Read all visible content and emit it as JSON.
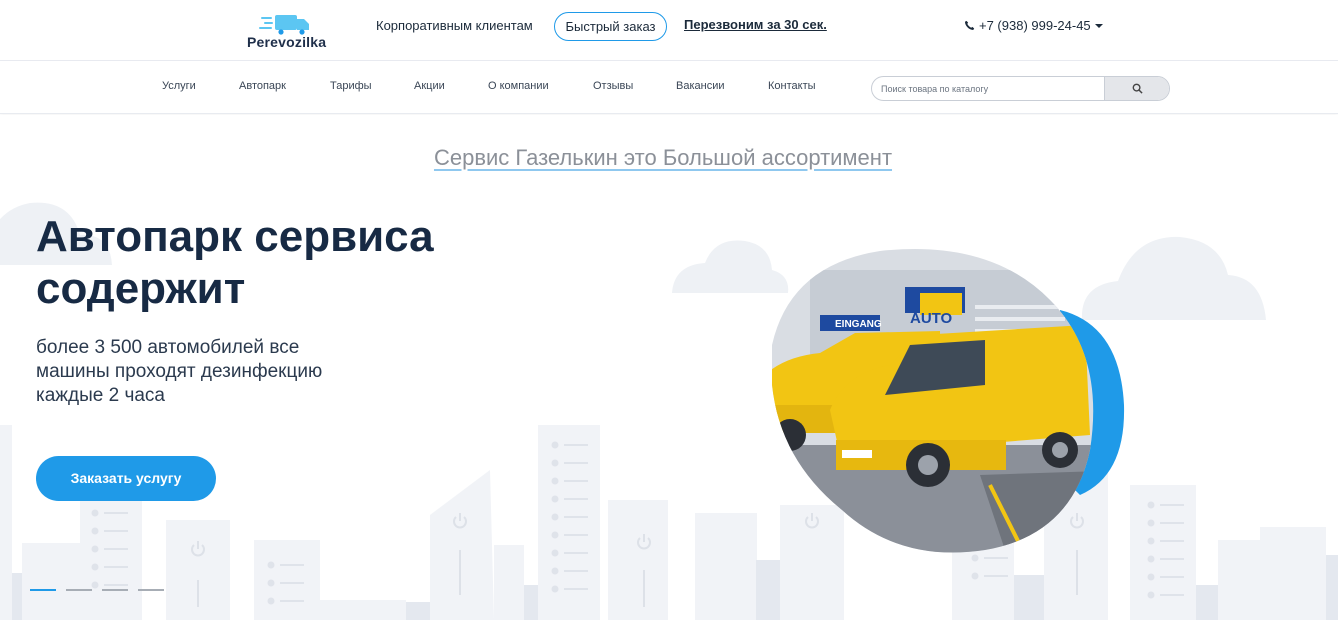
{
  "header": {
    "logo_text": "Perevozilka",
    "corporate_link": "Корпоративным клиентам",
    "quick_order_button": "Быстрый заказ",
    "callback_link": "Перезвоним за 30 сек.",
    "phone": "+7 (938) 999-24-45"
  },
  "nav": {
    "items": [
      "Услуги",
      "Автопарк",
      "Тарифы",
      "Акции",
      "О компании",
      "Отзывы",
      "Вакансии",
      "Контакты"
    ],
    "search_placeholder": "Поиск товара по каталогу"
  },
  "hero": {
    "tagline": "Сервис Газелькин это Большой ассортимент",
    "headline_line1": "Автопарк сервиса",
    "headline_line2": "содержит",
    "subtext": "более 3 500 автомобилей все машины проходят дезинфекцию каждые 2 часа",
    "cta_button": "Заказать услугу",
    "slides_count": 4,
    "active_slide": 1,
    "photo_signs": [
      "AUTO",
      "EINGANG"
    ]
  },
  "colors": {
    "accent": "#1f9ae8",
    "heading": "#172a44",
    "muted": "#8b9098",
    "skyline": "#f0f2f6",
    "van": "#f2c513"
  }
}
